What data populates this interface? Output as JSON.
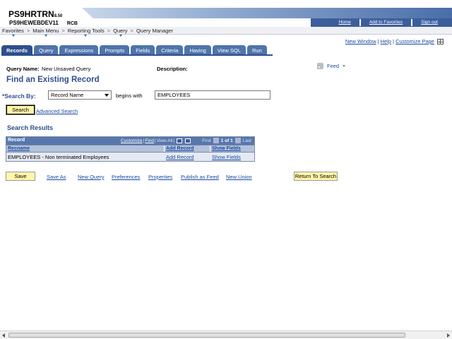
{
  "header": {
    "app_title": "PS9HRTRN",
    "version": "8.50",
    "database": "PS9HEWEBDEV11",
    "user": "RCB",
    "links": [
      "Home",
      "Add to Favorites",
      "Sign out"
    ]
  },
  "menubar": {
    "items": [
      "Favorites",
      "Main Menu",
      "Reporting Tools",
      "Query",
      "Query Manager"
    ],
    "separator": ">"
  },
  "toplinks": {
    "new_window": "New Window",
    "help": "Help",
    "customize_page": "Customize Page"
  },
  "tabs": [
    "Records",
    "Query",
    "Expressions",
    "Prompts",
    "Fields",
    "Criteria",
    "Having",
    "View SQL",
    "Run"
  ],
  "query": {
    "name_label": "Query Name:",
    "name_value": "New Unsaved Query",
    "description_label": "Description:",
    "feed_label": "Feed"
  },
  "page_title": "Find an Existing Record",
  "search": {
    "required_marker": "*",
    "search_by_label": "Search By:",
    "search_by_value": "Record Name",
    "operator_label": "begins with",
    "value": "EMPLOYEES",
    "search_button": "Search",
    "advanced_link": "Advanced Search"
  },
  "results": {
    "title": "Search Results",
    "grid_title": "Record",
    "customize": "Customize",
    "find": "Find",
    "view_all": "View All",
    "first": "First",
    "count": "1 of 1",
    "last": "Last",
    "columns": [
      "Recname",
      "Add Record",
      "Show Fields"
    ],
    "rows": [
      {
        "recname": "EMPLOYEES - Non terminated Employees",
        "add": "Add Record",
        "show": "Show Fields"
      }
    ]
  },
  "bottom": {
    "save": "Save",
    "save_as": "Save As",
    "new_query": "New Query",
    "preferences": "Preferences",
    "properties": "Properties",
    "publish_feed": "Publish as Feed",
    "new_union": "New Union",
    "return_to_search": "Return To Search"
  }
}
